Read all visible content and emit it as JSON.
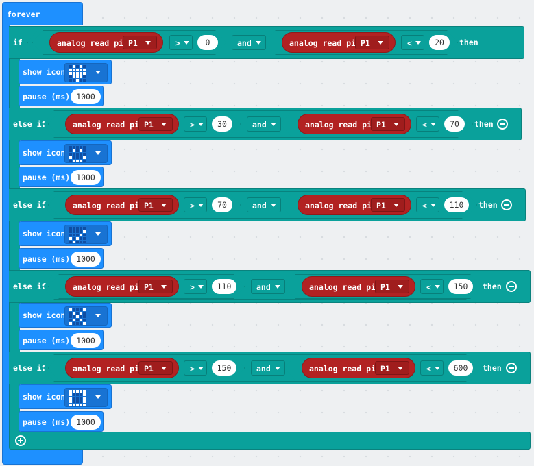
{
  "forever_label": "forever",
  "if_keyword": "if",
  "elseif_keyword": "else if",
  "then_keyword": "then",
  "analog_label": "analog read pin",
  "and_label": "and",
  "show_icon_label": "show icon",
  "pause_label": "pause (ms)",
  "branches": [
    {
      "pin1": "P1",
      "op1": ">",
      "v1": "0",
      "pin2": "P1",
      "op2": "<",
      "v2": "20",
      "pause": "1000",
      "icon": [
        0,
        1,
        0,
        1,
        0,
        1,
        1,
        1,
        1,
        1,
        1,
        1,
        1,
        1,
        1,
        0,
        1,
        1,
        1,
        0,
        0,
        0,
        1,
        0,
        0
      ]
    },
    {
      "pin1": "P1",
      "op1": ">",
      "v1": "30",
      "pin2": "P1",
      "op2": "<",
      "v2": "70",
      "pause": "1000",
      "icon": [
        0,
        0,
        0,
        0,
        0,
        0,
        1,
        0,
        1,
        0,
        0,
        0,
        0,
        0,
        0,
        1,
        0,
        0,
        0,
        1,
        0,
        1,
        1,
        1,
        0
      ]
    },
    {
      "pin1": "P1",
      "op1": ">",
      "v1": "70",
      "pin2": "P1",
      "op2": "<",
      "v2": "110",
      "pause": "1000",
      "icon": [
        0,
        0,
        0,
        0,
        0,
        0,
        0,
        0,
        0,
        1,
        0,
        0,
        0,
        1,
        0,
        1,
        0,
        1,
        0,
        0,
        0,
        1,
        0,
        0,
        0
      ]
    },
    {
      "pin1": "P1",
      "op1": ">",
      "v1": "110",
      "pin2": "P1",
      "op2": "<",
      "v2": "150",
      "pause": "1000",
      "icon": [
        1,
        0,
        0,
        0,
        1,
        0,
        1,
        0,
        1,
        0,
        0,
        0,
        1,
        0,
        0,
        0,
        1,
        0,
        1,
        0,
        1,
        0,
        0,
        0,
        1
      ]
    },
    {
      "pin1": "P1",
      "op1": ">",
      "v1": "150",
      "pin2": "P1",
      "op2": "<",
      "v2": "600",
      "pause": "1000",
      "icon": [
        1,
        1,
        1,
        1,
        1,
        1,
        0,
        0,
        0,
        1,
        1,
        0,
        0,
        0,
        1,
        1,
        0,
        0,
        0,
        1,
        1,
        1,
        1,
        1,
        1
      ]
    }
  ]
}
